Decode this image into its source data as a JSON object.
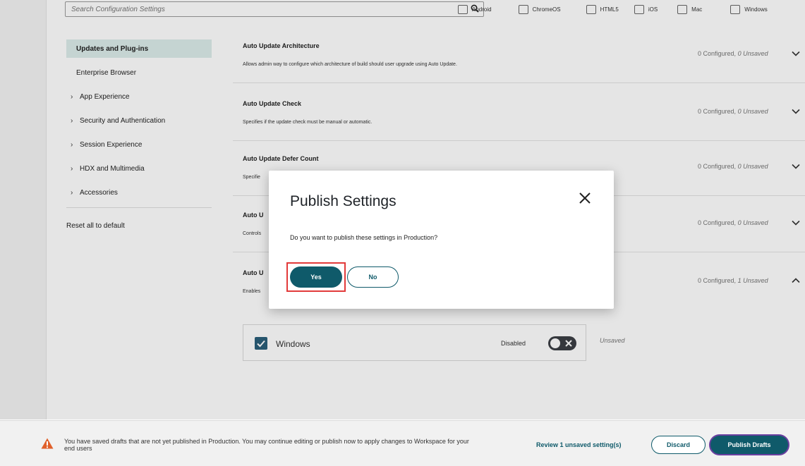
{
  "search": {
    "placeholder": "Search Configuration Settings"
  },
  "platforms": [
    "Android",
    "ChromeOS",
    "HTML5",
    "iOS",
    "Mac",
    "Windows"
  ],
  "sidebar": {
    "items": [
      {
        "label": "Updates and Plug-ins",
        "active": true
      },
      {
        "label": "Enterprise Browser"
      },
      {
        "label": "App Experience",
        "expandable": true
      },
      {
        "label": "Security and Authentication",
        "expandable": true
      },
      {
        "label": "Session Experience",
        "expandable": true
      },
      {
        "label": "HDX and Multimedia",
        "expandable": true
      },
      {
        "label": "Accessories",
        "expandable": true
      }
    ],
    "reset_label": "Reset all to default"
  },
  "settings": [
    {
      "title": "Auto Update Architecture",
      "description": "Allows admin way to configure which architecture of build should user upgrade using Auto Update.",
      "configured": "0 Configured,",
      "unsaved": "0 Unsaved",
      "expanded": false
    },
    {
      "title": "Auto Update Check",
      "description": "Specifies if the update check must be manual or automatic.",
      "configured": "0 Configured,",
      "unsaved": "0 Unsaved",
      "expanded": false
    },
    {
      "title": "Auto Update Defer Count",
      "description": "Specifie",
      "configured": "0 Configured,",
      "unsaved": "0 Unsaved",
      "expanded": false
    },
    {
      "title": "Auto U",
      "description": "Controls",
      "configured": "0 Configured,",
      "unsaved": "0 Unsaved",
      "expanded": false
    },
    {
      "title": "Auto U",
      "description": "Enables",
      "configured": "0 Configured,",
      "unsaved": "1 Unsaved",
      "expanded": true
    }
  ],
  "windows_option": {
    "label": "Windows",
    "state": "Disabled",
    "status": "Unsaved",
    "checked": true
  },
  "modal": {
    "title": "Publish Settings",
    "message": "Do you want to publish these settings in Production?",
    "yes_label": "Yes",
    "no_label": "No"
  },
  "footer": {
    "message": "You have saved drafts that are not yet published in Production. You may continue editing or publish now to apply changes to Workspace for your end users",
    "review_label": "Review 1 unsaved setting(s)",
    "discard_label": "Discard",
    "publish_label": "Publish Drafts"
  },
  "colors": {
    "accent": "#0f5a6a",
    "highlight": "#e23a3a",
    "warning": "#e0602a",
    "publish_ring": "#6a3fa0"
  }
}
